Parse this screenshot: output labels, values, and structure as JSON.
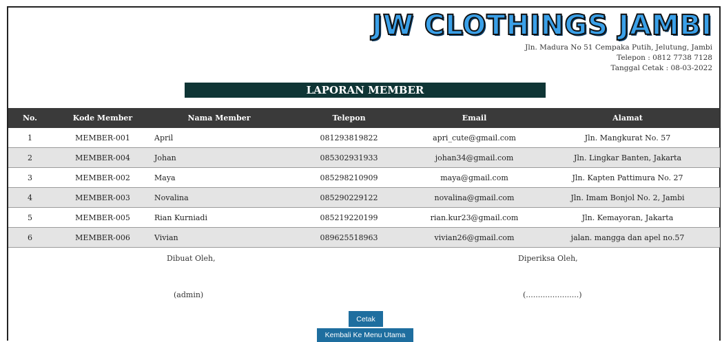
{
  "header": {
    "logo_text": "JW CLOTHINGS JAMBI",
    "address": "Jln. Madura No 51 Cempaka Putih, Jelutung, Jambi",
    "phone": "Telepon : 0812 7738 7128",
    "print_date": "Tanggal Cetak : 08-03-2022"
  },
  "report": {
    "title": "LAPORAN MEMBER"
  },
  "table": {
    "columns": [
      "No.",
      "Kode Member",
      "Nama Member",
      "Telepon",
      "Email",
      "Alamat"
    ],
    "rows": [
      [
        "1",
        "MEMBER-001",
        "April",
        "081293819822",
        "apri_cute@gmail.com",
        "Jln. Mangkurat No. 57"
      ],
      [
        "2",
        "MEMBER-004",
        "Johan",
        "085302931933",
        "johan34@gmail.com",
        "Jln. Lingkar Banten, Jakarta"
      ],
      [
        "3",
        "MEMBER-002",
        "Maya",
        "085298210909",
        "maya@gmail.com",
        "Jln. Kapten Pattimura No. 27"
      ],
      [
        "4",
        "MEMBER-003",
        "Novalina",
        "085290229122",
        "novalina@gmail.com",
        "Jln. Imam Bonjol No. 2, Jambi"
      ],
      [
        "5",
        "MEMBER-005",
        "Rian Kurniadi",
        "085219220199",
        "rian.kur23@gmail.com",
        "Jln. Kemayoran, Jakarta"
      ],
      [
        "6",
        "MEMBER-006",
        "Vivian",
        "089625518963",
        "vivian26@gmail.com",
        "jalan. mangga dan apel no.57"
      ]
    ]
  },
  "signatures": {
    "made_by_label": "Dibuat Oleh,",
    "made_by_name": "(admin)",
    "checked_by_label": "Diperiksa Oleh,",
    "checked_by_name": "(......................)"
  },
  "buttons": {
    "print": "Cetak",
    "back": "Kembali Ke Menu Utama"
  },
  "colors": {
    "title_bar": "#0f3535",
    "table_header": "#3a3a3a",
    "button": "#1e6e9f",
    "logo": "#3aa0e8"
  }
}
